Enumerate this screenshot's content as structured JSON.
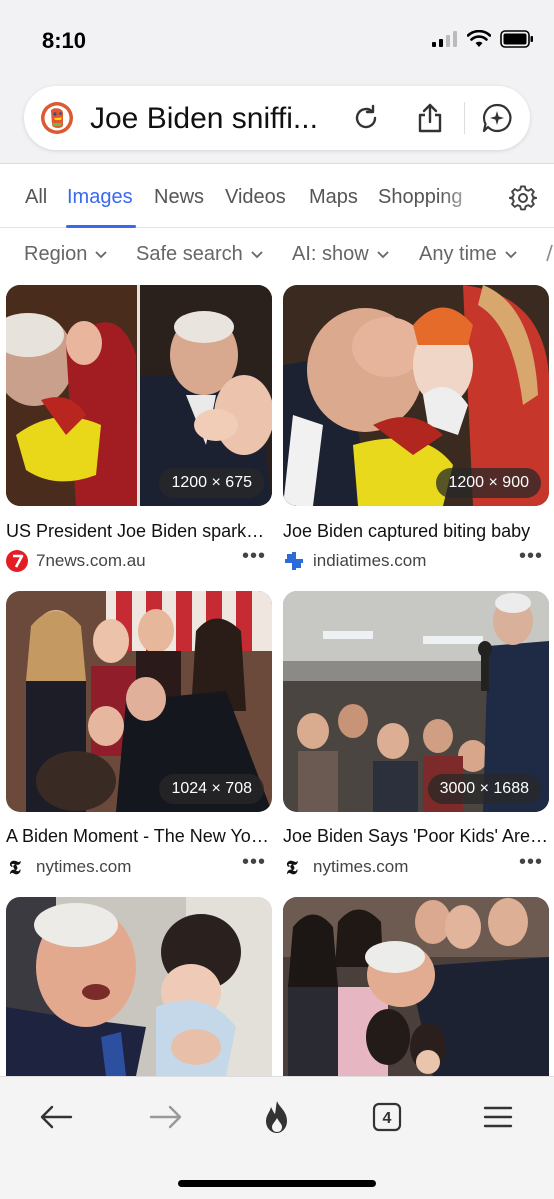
{
  "status_bar": {
    "time": "8:10",
    "icons": [
      "signal-icon",
      "wifi-icon",
      "battery-icon"
    ]
  },
  "search_bar": {
    "query": "Joe Biden sniffi...",
    "icons": [
      "duckduckgo-logo",
      "reload-icon",
      "share-icon",
      "ai-chat-icon"
    ]
  },
  "tabs": [
    {
      "label": "All",
      "active": false
    },
    {
      "label": "Images",
      "active": true
    },
    {
      "label": "News",
      "active": false
    },
    {
      "label": "Videos",
      "active": false
    },
    {
      "label": "Maps",
      "active": false
    },
    {
      "label": "Shopping",
      "active": false
    }
  ],
  "filters": [
    {
      "label": "Region"
    },
    {
      "label": "Safe search"
    },
    {
      "label": "AI: show"
    },
    {
      "label": "Any time"
    }
  ],
  "results": [
    {
      "dimensions": "1200 × 675",
      "caption": "US President Joe Biden sparks outrage",
      "source": "7news.com.au",
      "source_icon": "7news-icon"
    },
    {
      "dimensions": "1200 × 900",
      "caption": "Joe Biden captured biting baby",
      "source": "indiatimes.com",
      "source_icon": "indiatimes-icon"
    },
    {
      "dimensions": "1024 × 708",
      "caption": "A Biden Moment - The New York Times",
      "source": "nytimes.com",
      "source_icon": "nytimes-icon"
    },
    {
      "dimensions": "3000 × 1688",
      "caption": "Joe Biden Says 'Poor Kids' Are Just as Bright",
      "source": "nytimes.com",
      "source_icon": "nytimes-icon"
    },
    {
      "dimensions": "",
      "caption": "",
      "source": ""
    },
    {
      "dimensions": "",
      "caption": "",
      "source": ""
    }
  ],
  "more_label": "•••",
  "bottom_bar": {
    "tab_count": "4",
    "icons": [
      "back-arrow-icon",
      "forward-arrow-icon",
      "fire-icon",
      "tabs-icon",
      "menu-icon"
    ]
  },
  "colors": {
    "accent": "#3969ef",
    "text": "#111111",
    "muted": "#666666"
  }
}
